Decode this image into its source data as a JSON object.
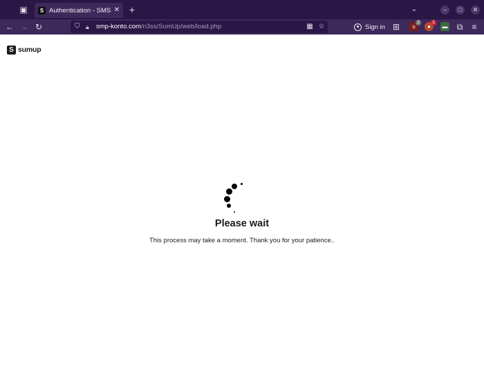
{
  "browser": {
    "tab": {
      "favicon_letter": "S",
      "title": "Authentication - SMS — SumUp",
      "close_glyph": "✕"
    },
    "new_tab_glyph": "+",
    "url": {
      "host": "smp-konto.com",
      "path": "/n3ss/SumUp/web/load.php"
    },
    "sign_in_label": "Sign in",
    "extensions": [
      {
        "name": "ublock-origin",
        "badge": "2",
        "color": "#7a1c1c"
      },
      {
        "name": "privacy-badger",
        "badge": "1",
        "color": "#b24a2a"
      },
      {
        "name": "ext-generic",
        "badge": "",
        "color": "#3c6b3c"
      }
    ]
  },
  "page": {
    "logo_letter": "S",
    "logo_text": "sumup",
    "title": "Please wait",
    "message": "This process may take a moment. Thank you for your patience.."
  }
}
